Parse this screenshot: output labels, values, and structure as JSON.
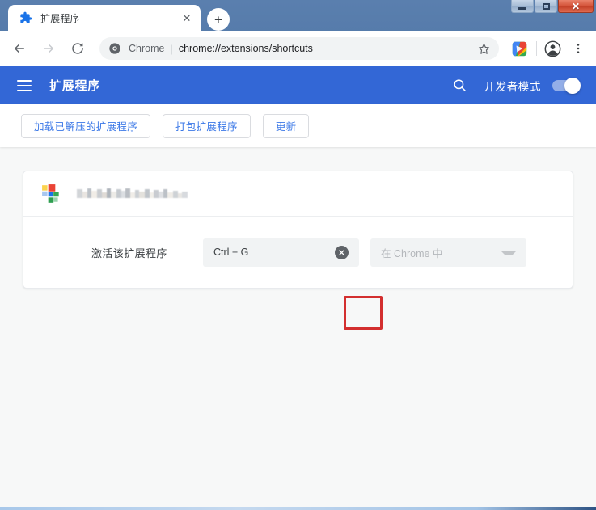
{
  "window": {
    "controls": {
      "minimize_label": "–",
      "maximize_label": "",
      "close_label": "✕"
    }
  },
  "tabstrip": {
    "tabs": [
      {
        "title": "扩展程序",
        "favicon": "puzzle-piece-icon",
        "close_label": "✕",
        "active": true
      }
    ],
    "new_tab_label": "+"
  },
  "toolbar": {
    "back_label": "←",
    "forward_label": "→",
    "reload_label": "↻",
    "omnibox": {
      "site_icon": "chrome-icon",
      "scheme_label": "Chrome",
      "separator": "|",
      "url": "chrome://extensions/shortcuts",
      "star_label": "☆"
    },
    "extension_icon": "colorful-extension-icon",
    "profile_label": "profile-avatar-icon",
    "menu_label": "⋮"
  },
  "extensions_page": {
    "header": {
      "menu_icon": "hamburger-menu-icon",
      "title": "扩展程序",
      "search_icon": "search-icon",
      "dev_mode_label": "开发者模式",
      "dev_mode_on": true
    },
    "action_buttons": [
      {
        "label": "加载已解压的扩展程序",
        "name": "load-unpacked-button"
      },
      {
        "label": "打包扩展程序",
        "name": "pack-extension-button"
      },
      {
        "label": "更新",
        "name": "update-button"
      }
    ],
    "shortcut_card": {
      "extension_icon": "multicolor-squares-icon",
      "extension_name_redacted": true,
      "rows": [
        {
          "label": "激活该扩展程序",
          "shortcut_value": "Ctrl + G",
          "clear_label": "✕",
          "scope_value": "在 Chrome 中"
        }
      ]
    },
    "annotation": {
      "type": "highlight-rectangle",
      "color": "#d32f2f",
      "target": "clear-shortcut-button"
    }
  },
  "colors": {
    "header_blue": "#3367d6",
    "link_blue": "#3b78e7",
    "annotation_red": "#d32f2f",
    "field_gray": "#f1f3f4",
    "page_bg": "#f7f8f8"
  }
}
